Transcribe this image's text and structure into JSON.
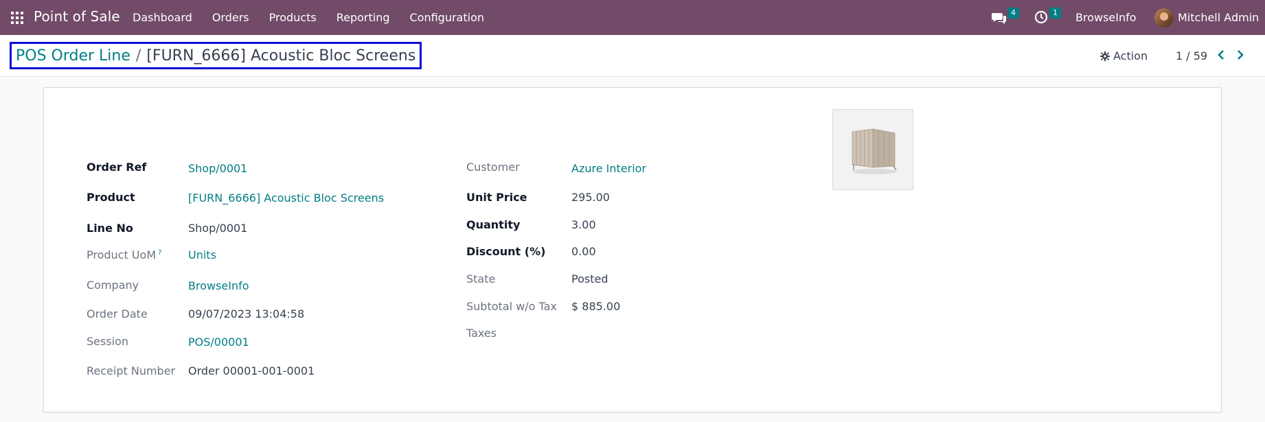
{
  "navbar": {
    "app_name": "Point of Sale",
    "menu": [
      "Dashboard",
      "Orders",
      "Products",
      "Reporting",
      "Configuration"
    ],
    "messages_count": "4",
    "activities_count": "1",
    "company": "BrowseInfo",
    "user": "Mitchell Admin",
    "icons": {
      "apps": "apps-grid-icon",
      "messages": "chat-icon",
      "activities": "clock-icon"
    },
    "colors": {
      "navbar": "#714b67",
      "accent": "#017e84"
    }
  },
  "control_panel": {
    "breadcrumb_parent": "POS Order Line",
    "breadcrumb_separator": "/",
    "breadcrumb_current": "[FURN_6666] Acoustic Bloc Screens",
    "action_label": "Action",
    "pager": "1 / 59"
  },
  "form": {
    "left": [
      {
        "label": "Order Ref",
        "value": "Shop/0001"
      },
      {
        "label": "Product",
        "value": "[FURN_6666] Acoustic Bloc Screens"
      },
      {
        "label": "Line No",
        "value": "Shop/0001"
      },
      {
        "label": "Product UoM",
        "help": "?",
        "value": "Units"
      },
      {
        "label": "Company",
        "value": "BrowseInfo"
      },
      {
        "label": "Order Date",
        "value": "09/07/2023 13:04:58"
      },
      {
        "label": "Session",
        "value": "POS/00001"
      },
      {
        "label": "Receipt Number",
        "value": "Order 00001-001-0001"
      }
    ],
    "right": [
      {
        "label": "Customer",
        "value": "Azure Interior"
      },
      {
        "label": "Unit Price",
        "value": "295.00"
      },
      {
        "label": "Quantity",
        "value": "3.00"
      },
      {
        "label": "Discount (%)",
        "value": "0.00"
      },
      {
        "label": "State",
        "value": "Posted"
      },
      {
        "label": "Subtotal w/o Tax",
        "value": "$ 885.00"
      },
      {
        "label": "Taxes",
        "value": ""
      }
    ]
  }
}
